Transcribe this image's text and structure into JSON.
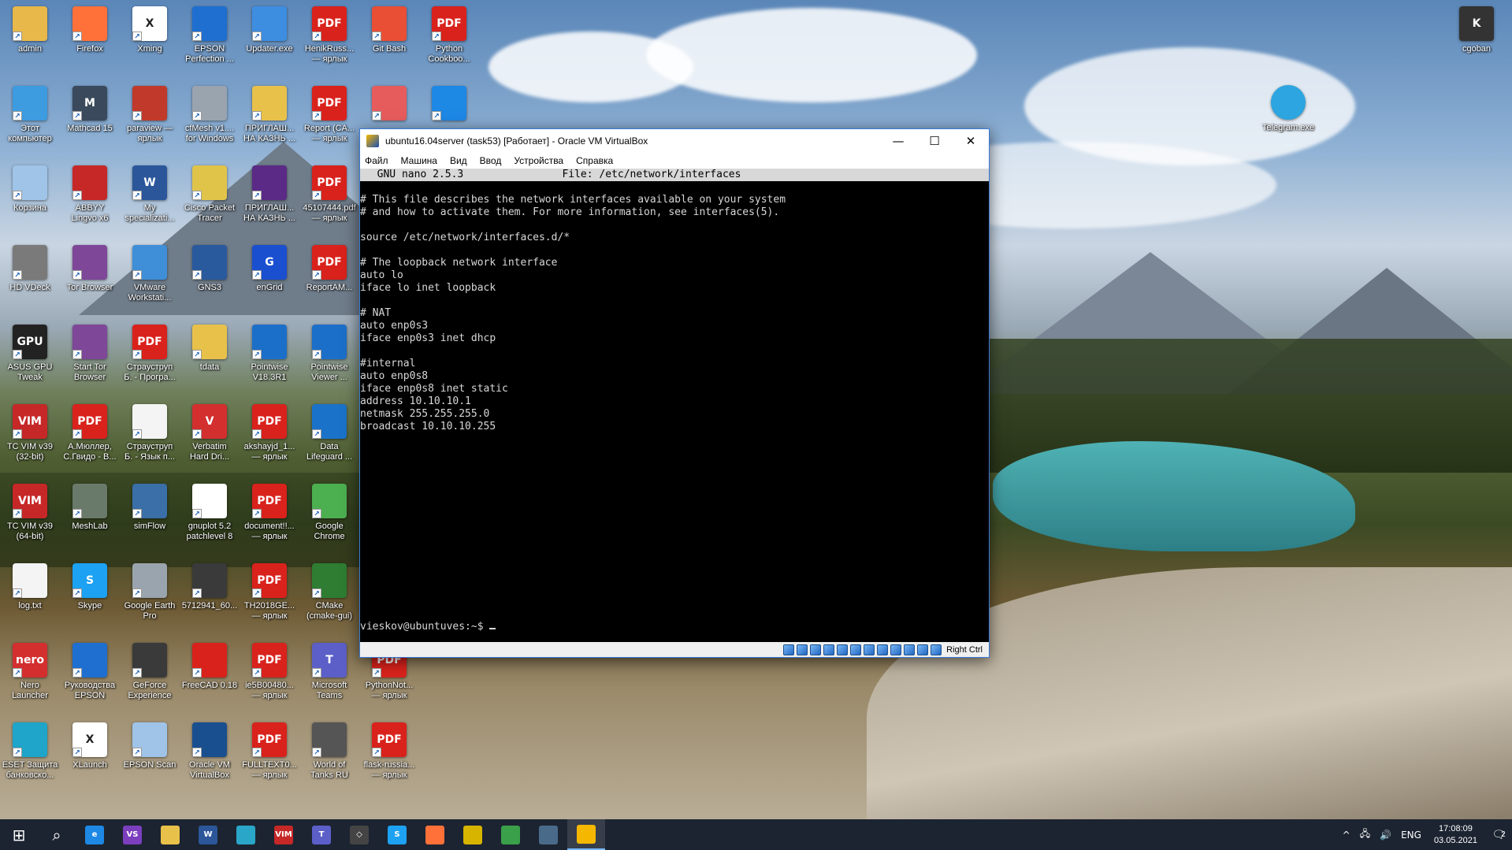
{
  "desktop_icons": [
    {
      "label": "admin",
      "glyph": "",
      "color": "#e8b84a",
      "col": 0,
      "row": 0
    },
    {
      "label": "Firefox",
      "glyph": "",
      "color": "#ff7139",
      "col": 1,
      "row": 0
    },
    {
      "label": "Xming",
      "glyph": "X",
      "color": "#ffffff",
      "col": 2,
      "row": 0
    },
    {
      "label": "EPSON\nPerfection ...",
      "glyph": "",
      "color": "#1f6fd1",
      "col": 3,
      "row": 0
    },
    {
      "label": "Updater.exe",
      "glyph": "",
      "color": "#3d8de0",
      "col": 4,
      "row": 0
    },
    {
      "label": "HenikRuss...\n— ярлык",
      "glyph": "PDF",
      "color": "#d9221c",
      "col": 5,
      "row": 0
    },
    {
      "label": "Git Bash",
      "glyph": "",
      "color": "#e94f35",
      "col": 6,
      "row": 0
    },
    {
      "label": "Python\nCookboo...",
      "glyph": "PDF",
      "color": "#d9221c",
      "col": 7,
      "row": 0
    },
    {
      "label": "Этот\nкомпьютер",
      "glyph": "",
      "color": "#3d9be0",
      "col": 0,
      "row": 1
    },
    {
      "label": "Mathcad 15",
      "glyph": "M",
      "color": "#3a4a5c",
      "col": 1,
      "row": 1
    },
    {
      "label": "paraview —\nярлык",
      "glyph": "",
      "color": "#c0392b",
      "col": 2,
      "row": 1
    },
    {
      "label": "cfMesh v1....\nfor Windows",
      "glyph": "",
      "color": "#9aa4ae",
      "col": 3,
      "row": 1
    },
    {
      "label": "ПРИГЛАШ...\nНА КАЗНЬ ...",
      "glyph": "",
      "color": "#e8c14a",
      "col": 4,
      "row": 1
    },
    {
      "label": "Report (CA...\n— ярлык",
      "glyph": "PDF",
      "color": "#d9221c",
      "col": 5,
      "row": 1
    },
    {
      "label": "",
      "glyph": "",
      "color": "#e65c5c",
      "col": 6,
      "row": 1
    },
    {
      "label": "",
      "glyph": "",
      "color": "#1e88e5",
      "col": 7,
      "row": 1
    },
    {
      "label": "Корзина",
      "glyph": "",
      "color": "#9fc4e8",
      "col": 0,
      "row": 2
    },
    {
      "label": "ABBYY\nLingvo x6",
      "glyph": "",
      "color": "#c62828",
      "col": 1,
      "row": 2
    },
    {
      "label": "My\nspecializati...",
      "glyph": "W",
      "color": "#2b579a",
      "col": 2,
      "row": 2
    },
    {
      "label": "Cisco Packet\nTracer",
      "glyph": "",
      "color": "#e0c44a",
      "col": 3,
      "row": 2
    },
    {
      "label": "ПРИГЛАШ...\nНА КАЗНЬ ...",
      "glyph": "",
      "color": "#5b2a86",
      "col": 4,
      "row": 2
    },
    {
      "label": "45107444.pdf\n— ярлык",
      "glyph": "PDF",
      "color": "#d9221c",
      "col": 5,
      "row": 2
    },
    {
      "label": "HD VDeck",
      "glyph": "",
      "color": "#7a7a7a",
      "col": 0,
      "row": 3
    },
    {
      "label": "Tor Browser",
      "glyph": "",
      "color": "#7e4798",
      "col": 1,
      "row": 3
    },
    {
      "label": "VMware\nWorkstati...",
      "glyph": "",
      "color": "#3f8fd8",
      "col": 2,
      "row": 3
    },
    {
      "label": "GNS3",
      "glyph": "",
      "color": "#2a5a9e",
      "col": 3,
      "row": 3
    },
    {
      "label": "enGrid",
      "glyph": "G",
      "color": "#1a4fd0",
      "col": 4,
      "row": 3
    },
    {
      "label": "ReportAM...",
      "glyph": "PDF",
      "color": "#d9221c",
      "col": 5,
      "row": 3
    },
    {
      "label": "ASUS GPU\nTweak",
      "glyph": "GPU",
      "color": "#222222",
      "col": 0,
      "row": 4
    },
    {
      "label": "Start Tor\nBrowser",
      "glyph": "",
      "color": "#7e4798",
      "col": 1,
      "row": 4
    },
    {
      "label": "Страуструп\nБ. - Програ...",
      "glyph": "PDF",
      "color": "#d9221c",
      "col": 2,
      "row": 4
    },
    {
      "label": "tdata",
      "glyph": "",
      "color": "#e8c14a",
      "col": 3,
      "row": 4
    },
    {
      "label": "Pointwise\nV18.3R1",
      "glyph": "",
      "color": "#1c6fc9",
      "col": 4,
      "row": 4
    },
    {
      "label": "Pointwise\nViewer ...",
      "glyph": "",
      "color": "#1c6fc9",
      "col": 5,
      "row": 4
    },
    {
      "label": "TC VIM v39\n(32-bit)",
      "glyph": "VIM",
      "color": "#c62828",
      "col": 0,
      "row": 5
    },
    {
      "label": "А.Мюллер,\nС.Гвидо - В...",
      "glyph": "PDF",
      "color": "#d9221c",
      "col": 1,
      "row": 5
    },
    {
      "label": "Страуструп\nБ. - Язык п...",
      "glyph": "",
      "color": "#f4f4f4",
      "col": 2,
      "row": 5
    },
    {
      "label": "Verbatim\nHard Dri...",
      "glyph": "V",
      "color": "#d32f2f",
      "col": 3,
      "row": 5
    },
    {
      "label": "akshayjd_1...\n— ярлык",
      "glyph": "PDF",
      "color": "#d9221c",
      "col": 4,
      "row": 5
    },
    {
      "label": "Data\nLifeguard ...",
      "glyph": "",
      "color": "#1a73c9",
      "col": 5,
      "row": 5
    },
    {
      "label": "TC VIM v39\n(64-bit)",
      "glyph": "VIM",
      "color": "#c62828",
      "col": 0,
      "row": 6
    },
    {
      "label": "MeshLab",
      "glyph": "",
      "color": "#6a7a6a",
      "col": 1,
      "row": 6
    },
    {
      "label": "simFlow",
      "glyph": "",
      "color": "#3a6fa8",
      "col": 2,
      "row": 6
    },
    {
      "label": "gnuplot 5.2\npatchlevel 8",
      "glyph": "",
      "color": "#ffffff",
      "col": 3,
      "row": 6
    },
    {
      "label": "document!!...\n— ярлык",
      "glyph": "PDF",
      "color": "#d9221c",
      "col": 4,
      "row": 6
    },
    {
      "label": "Google\nChrome",
      "glyph": "",
      "color": "#4caf50",
      "col": 5,
      "row": 6
    },
    {
      "label": "log.txt",
      "glyph": "",
      "color": "#f4f4f4",
      "col": 0,
      "row": 7
    },
    {
      "label": "Skype",
      "glyph": "S",
      "color": "#1da1f2",
      "col": 1,
      "row": 7
    },
    {
      "label": "Google Earth\nPro",
      "glyph": "",
      "color": "#9aa4ae",
      "col": 2,
      "row": 7
    },
    {
      "label": "5712941_60...",
      "glyph": "",
      "color": "#3a3a3a",
      "col": 3,
      "row": 7
    },
    {
      "label": "TH2018GE...\n— ярлык",
      "glyph": "PDF",
      "color": "#d9221c",
      "col": 4,
      "row": 7
    },
    {
      "label": "CMake\n(cmake-gui)",
      "glyph": "",
      "color": "#2e7d32",
      "col": 5,
      "row": 7
    },
    {
      "label": "Nero\nLauncher",
      "glyph": "nero",
      "color": "#d32f2f",
      "col": 0,
      "row": 8
    },
    {
      "label": "Руководства\nEPSON",
      "glyph": "",
      "color": "#1f6fd1",
      "col": 1,
      "row": 8
    },
    {
      "label": "GeForce\nExperience",
      "glyph": "",
      "color": "#3a3a3a",
      "col": 2,
      "row": 8
    },
    {
      "label": "FreeCAD 0.18",
      "glyph": "",
      "color": "#d9221c",
      "col": 3,
      "row": 8
    },
    {
      "label": "ie5B00480...\n— ярлык",
      "glyph": "PDF",
      "color": "#d9221c",
      "col": 4,
      "row": 8
    },
    {
      "label": "Microsoft\nTeams",
      "glyph": "T",
      "color": "#5b5fc7",
      "col": 5,
      "row": 8
    },
    {
      "label": "PythonNot...\n— ярлык",
      "glyph": "PDF",
      "color": "#d9221c",
      "col": 6,
      "row": 8
    },
    {
      "label": "ESET Защита\nбанковско...",
      "glyph": "",
      "color": "#1fa5c9",
      "col": 0,
      "row": 9
    },
    {
      "label": "XLaunch",
      "glyph": "X",
      "color": "#ffffff",
      "col": 1,
      "row": 9
    },
    {
      "label": "EPSON Scan",
      "glyph": "",
      "color": "#9fc4e8",
      "col": 2,
      "row": 9
    },
    {
      "label": "Oracle VM\nVirtualBox",
      "glyph": "",
      "color": "#1a4f8f",
      "col": 3,
      "row": 9
    },
    {
      "label": "FULLTEXT0...\n— ярлык",
      "glyph": "PDF",
      "color": "#d9221c",
      "col": 4,
      "row": 9
    },
    {
      "label": "World of\nTanks RU",
      "glyph": "",
      "color": "#555555",
      "col": 5,
      "row": 9
    },
    {
      "label": "flask-russia...\n— ярлык",
      "glyph": "PDF",
      "color": "#d9221c",
      "col": 6,
      "row": 9
    }
  ],
  "right_icons": [
    {
      "label": "cgoban",
      "glyph": "K",
      "color": "#333333"
    },
    {
      "label": "Telegram.exe",
      "glyph": "",
      "color": "#2ca5e0"
    }
  ],
  "vbox": {
    "title": "ubuntu16.04server (task53) [Работает] - Oracle VM VirtualBox",
    "menu": [
      "Файл",
      "Машина",
      "Вид",
      "Ввод",
      "Устройства",
      "Справка"
    ],
    "minimize": "—",
    "maximize": "☐",
    "close": "✕",
    "nano_header": "  GNU nano 2.5.3                File: /etc/network/interfaces",
    "file_lines": [
      "# This file describes the network interfaces available on your system",
      "# and how to activate them. For more information, see interfaces(5).",
      "",
      "source /etc/network/interfaces.d/*",
      "",
      "# The loopback network interface",
      "auto lo",
      "iface lo inet loopback",
      "",
      "# NAT",
      "auto enp0s3",
      "iface enp0s3 inet dhcp",
      "",
      "#internal",
      "auto enp0s8",
      "iface enp0s8 inet static",
      "address 10.10.10.1",
      "netmask 255.255.255.0",
      "broadcast 10.10.10.255"
    ],
    "prompt": "vieskov@ubuntuves:~$ ",
    "host_key": "Right Ctrl",
    "status_icons": 12
  },
  "taskbar": {
    "start_icon": "⊞",
    "search_icon": "⌕",
    "apps": [
      {
        "name": "edge",
        "color": "#1e88e5",
        "glyph": "e"
      },
      {
        "name": "visual-studio",
        "color": "#7b3fbe",
        "glyph": "VS"
      },
      {
        "name": "file-explorer",
        "color": "#e8c14a",
        "glyph": ""
      },
      {
        "name": "word",
        "color": "#2b579a",
        "glyph": "W"
      },
      {
        "name": "sticky",
        "color": "#2aa6c9",
        "glyph": ""
      },
      {
        "name": "vim",
        "color": "#c62828",
        "glyph": "VIM"
      },
      {
        "name": "teams",
        "color": "#5b5fc7",
        "glyph": "T"
      },
      {
        "name": "virtualbox-cube",
        "color": "#444444",
        "glyph": "◇"
      },
      {
        "name": "skype",
        "color": "#1da1f2",
        "glyph": "S"
      },
      {
        "name": "firefox",
        "color": "#ff7139",
        "glyph": ""
      },
      {
        "name": "dotnet",
        "color": "#d6b400",
        "glyph": ""
      },
      {
        "name": "notepad",
        "color": "#3aa04a",
        "glyph": ""
      },
      {
        "name": "screen-tool",
        "color": "#4a6a8a",
        "glyph": ""
      },
      {
        "name": "virtualbox-active",
        "color": "#f5b700",
        "glyph": ""
      }
    ],
    "tray_chevron": "^",
    "language": "ENG",
    "time": "17:08:09",
    "date": "03.05.2021",
    "notifications_count": "2"
  }
}
